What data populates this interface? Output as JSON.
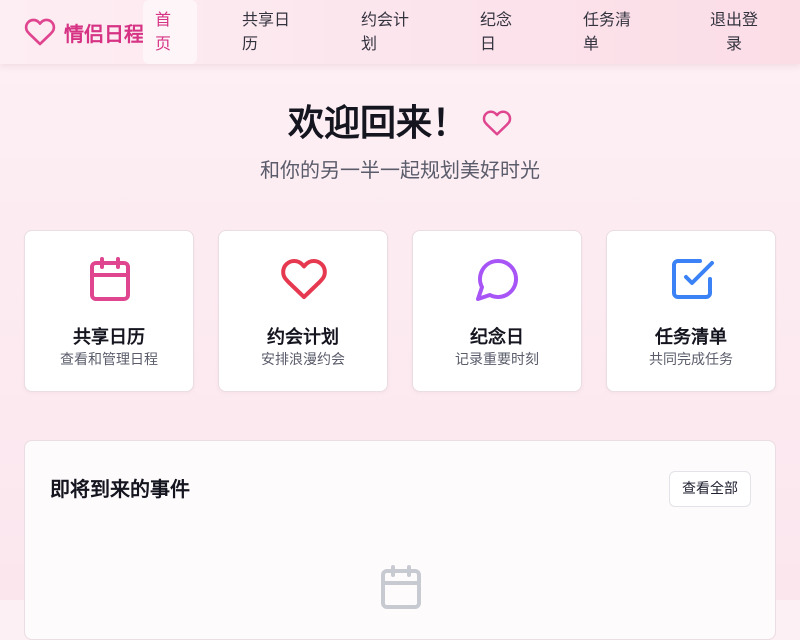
{
  "app": {
    "name": "情侣日程"
  },
  "nav": [
    {
      "lines": [
        "首",
        "页"
      ],
      "active": true
    },
    {
      "lines": [
        "共享日",
        "历"
      ]
    },
    {
      "lines": [
        "约会计",
        "划"
      ]
    },
    {
      "lines": [
        "纪念",
        "日"
      ]
    },
    {
      "lines": [
        "任务清",
        "单"
      ]
    },
    {
      "lines": [
        "退出登",
        "录"
      ]
    }
  ],
  "hero": {
    "title": "欢迎回来！",
    "subtitle": "和你的另一半一起规划美好时光"
  },
  "cards": [
    {
      "title": "共享日历",
      "subtitle": "查看和管理日程",
      "icon": "calendar-icon",
      "color": "#e0458f"
    },
    {
      "title": "约会计划",
      "subtitle": "安排浪漫约会",
      "icon": "heart-icon",
      "color": "#e63950"
    },
    {
      "title": "纪念日",
      "subtitle": "记录重要时刻",
      "icon": "message-circle-icon",
      "color": "#a855f7"
    },
    {
      "title": "任务清单",
      "subtitle": "共同完成任务",
      "icon": "check-square-icon",
      "color": "#3b82f6"
    }
  ],
  "events": {
    "title": "即将到来的事件",
    "view_all": "查看全部"
  },
  "colors": {
    "brand": "#d63384",
    "empty_icon": "#c8cad2"
  }
}
